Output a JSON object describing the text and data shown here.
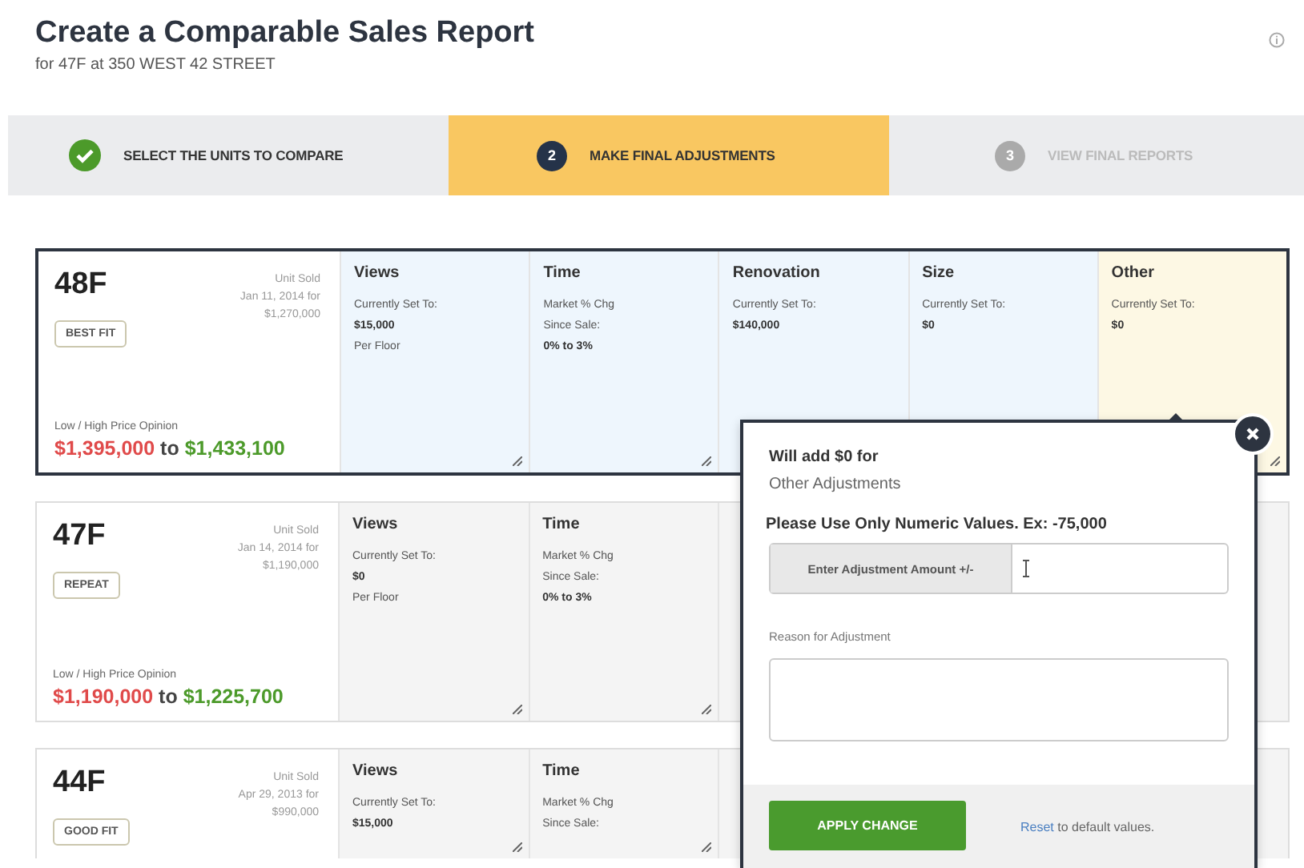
{
  "header": {
    "title": "Create a Comparable Sales Report",
    "subtitle": "for 47F at 350 WEST 42 STREET"
  },
  "steps": [
    {
      "kind": "done",
      "label": "SELECT THE UNITS TO COMPARE"
    },
    {
      "kind": "current",
      "number": "2",
      "label": "MAKE FINAL ADJUSTMENTS"
    },
    {
      "kind": "upcoming",
      "number": "3",
      "label": "VIEW FINAL REPORTS"
    }
  ],
  "cards": [
    {
      "unit": "48F",
      "selected": true,
      "sold": [
        "Unit Sold",
        "Jan 11, 2014 for",
        "$1,270,000"
      ],
      "tag": "BEST FIT",
      "price_label": "Low / High Price Opinion",
      "price_low": "$1,395,000",
      "price_sep": "to",
      "price_high": "$1,433,100",
      "adjustments": [
        {
          "title": "Views",
          "active": false,
          "lines": [
            {
              "text": "Currently Set To:",
              "bold": false
            },
            {
              "text": "$15,000",
              "bold": true
            },
            {
              "text": "Per Floor",
              "bold": false
            }
          ]
        },
        {
          "title": "Time",
          "active": false,
          "lines": [
            {
              "text": "Market % Chg",
              "bold": false
            },
            {
              "text": "Since Sale:",
              "bold": false
            },
            {
              "text": "0% to 3%",
              "bold": true
            }
          ]
        },
        {
          "title": "Renovation",
          "active": false,
          "lines": [
            {
              "text": "Currently Set To:",
              "bold": false
            },
            {
              "text": "$140,000",
              "bold": true
            }
          ]
        },
        {
          "title": "Size",
          "active": false,
          "lines": [
            {
              "text": "Currently Set To:",
              "bold": false
            },
            {
              "text": "$0",
              "bold": true
            }
          ]
        },
        {
          "title": "Other",
          "active": true,
          "lines": [
            {
              "text": "Currently Set To:",
              "bold": false
            },
            {
              "text": "$0",
              "bold": true
            }
          ]
        }
      ]
    },
    {
      "unit": "47F",
      "selected": false,
      "sold": [
        "Unit Sold",
        "Jan 14, 2014 for",
        "$1,190,000"
      ],
      "tag": "REPEAT",
      "price_label": "Low / High Price Opinion",
      "price_low": "$1,190,000",
      "price_sep": "to",
      "price_high": "$1,225,700",
      "adjustments": [
        {
          "title": "Views",
          "active": false,
          "lines": [
            {
              "text": "Currently Set To:",
              "bold": false
            },
            {
              "text": "$0",
              "bold": true
            },
            {
              "text": "Per Floor",
              "bold": false
            }
          ]
        },
        {
          "title": "Time",
          "active": false,
          "lines": [
            {
              "text": "Market % Chg",
              "bold": false
            },
            {
              "text": "Since Sale:",
              "bold": false
            },
            {
              "text": "0% to 3%",
              "bold": true
            }
          ]
        }
      ]
    },
    {
      "unit": "44F",
      "selected": false,
      "sold": [
        "Unit Sold",
        "Apr 29, 2013 for",
        "$990,000"
      ],
      "tag": "GOOD FIT",
      "adjustments": [
        {
          "title": "Views",
          "active": false,
          "lines": [
            {
              "text": "Currently Set To:",
              "bold": false
            },
            {
              "text": "$15,000",
              "bold": true
            }
          ]
        },
        {
          "title": "Time",
          "active": false,
          "lines": [
            {
              "text": "Market % Chg",
              "bold": false
            },
            {
              "text": "Since Sale:",
              "bold": false
            }
          ]
        }
      ]
    }
  ],
  "popup": {
    "heading": "Will add $0 for",
    "subheading": "Other Adjustments",
    "warning": "Please Use Only Numeric Values. Ex: -75,000",
    "amount_label": "Enter Adjustment Amount +/-",
    "reason_label": "Reason for Adjustment",
    "apply_button": "APPLY CHANGE",
    "reset_link": "Reset",
    "reset_text": "to default values."
  }
}
